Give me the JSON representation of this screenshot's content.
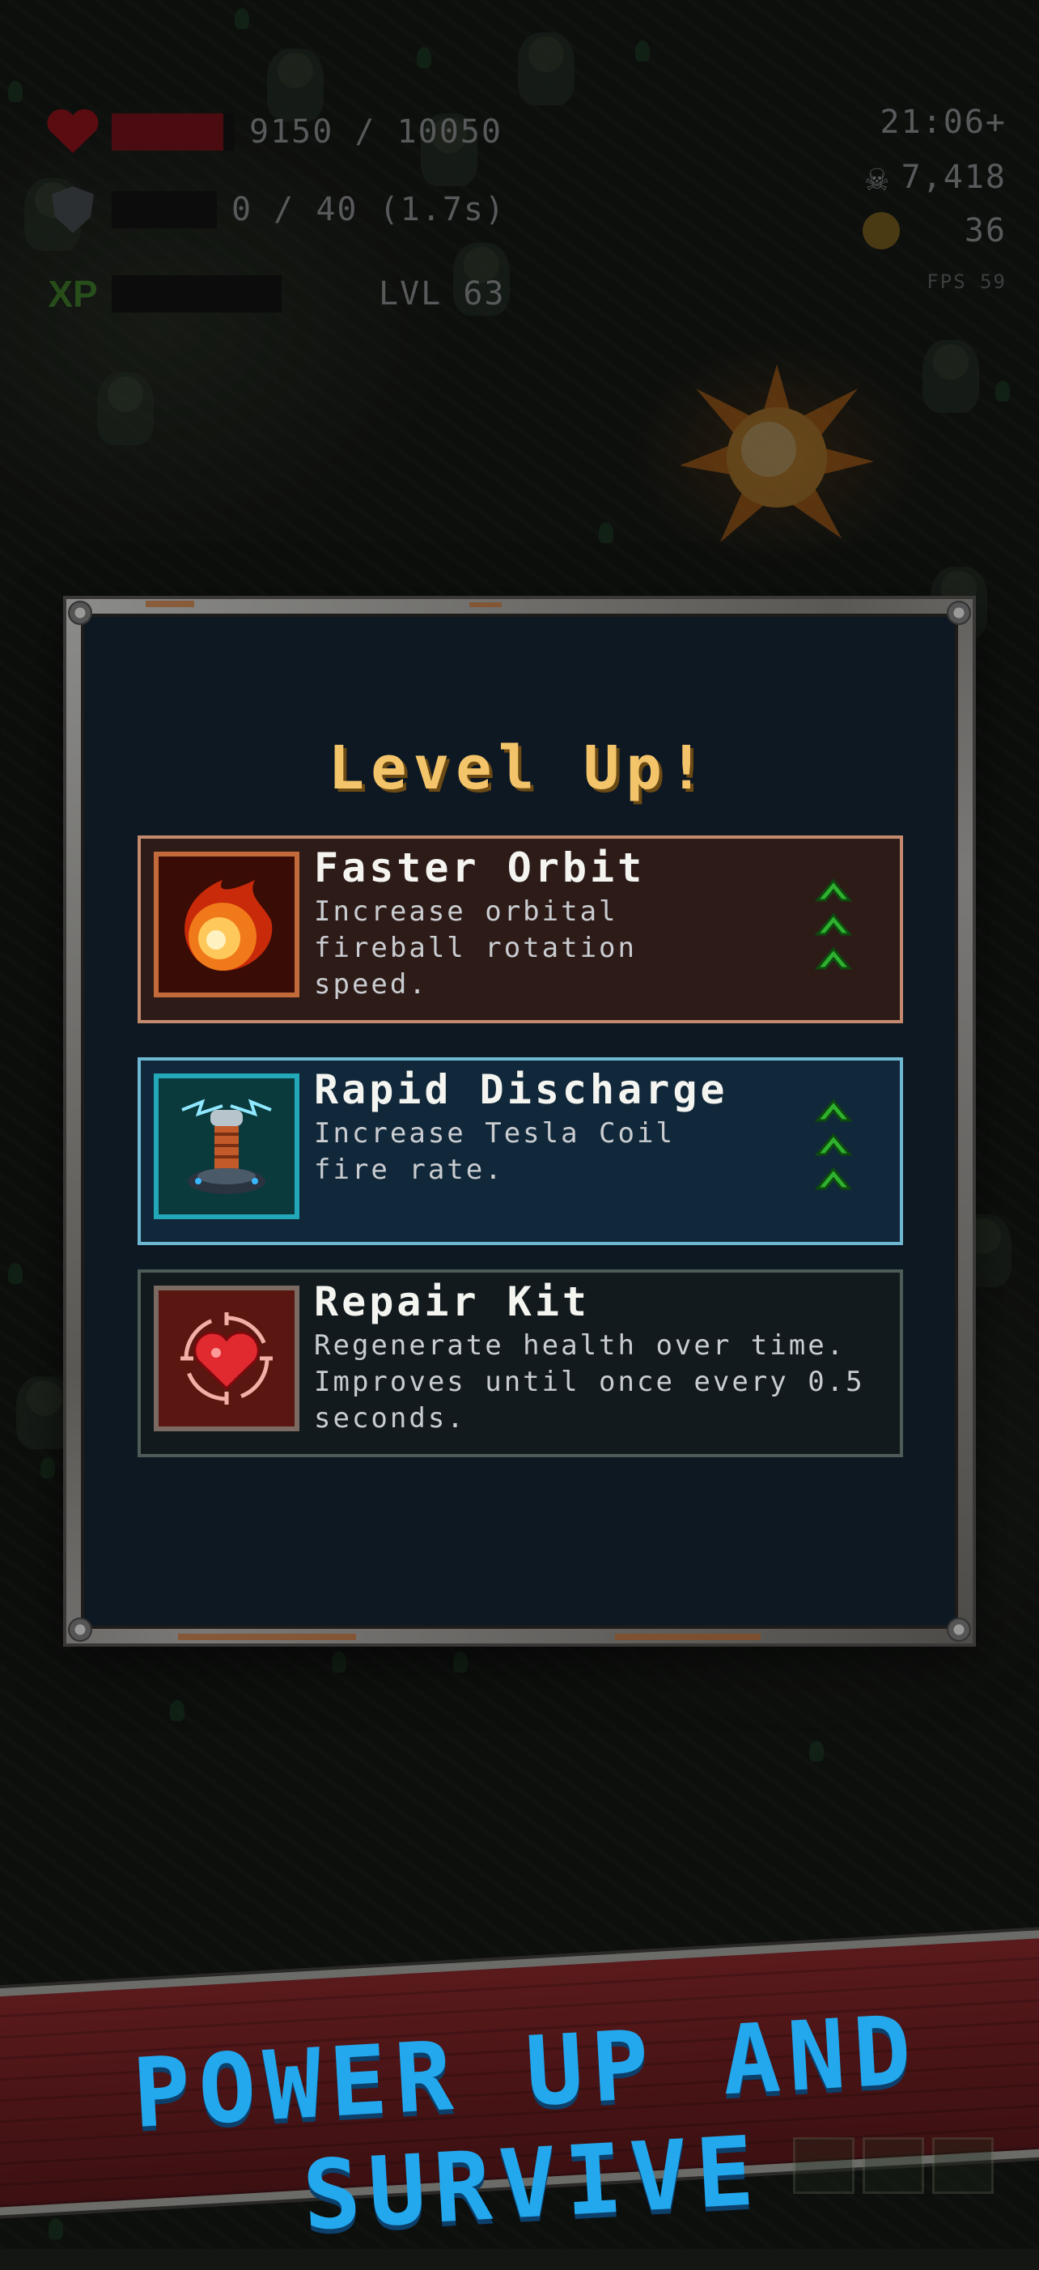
{
  "hud": {
    "health_text": "9150 / 10050",
    "health_fraction": 0.91,
    "shield_text": "0 / 40 (1.7s)",
    "shield_fraction": 0,
    "xp_label": "XP",
    "level_text": "LVL 63",
    "timer": "21:06+",
    "kills": "7,418",
    "coins": "36",
    "fps": "FPS 59"
  },
  "dialog": {
    "title": "Level Up!",
    "options": [
      {
        "title": "Faster Orbit",
        "description": "Increase orbital\nfireball rotation\nspeed.",
        "icon": "fireball-icon",
        "upgrade_arrows": 3
      },
      {
        "title": "Rapid Discharge",
        "description": "Increase Tesla Coil\nfire rate.",
        "icon": "tesla-coil-icon",
        "upgrade_arrows": 3
      },
      {
        "title": "Repair Kit",
        "description": "Regenerate health over time.\nImproves until once every 0.5\nseconds.",
        "icon": "heart-target-icon",
        "upgrade_arrows": 0
      }
    ]
  },
  "banner": {
    "text": "POWER UP AND SURVIVE"
  },
  "colors": {
    "title_gold": "#f4c46a",
    "banner_blue": "#23a8ee",
    "arrow_green": "#2fb12f",
    "health_red": "#4a0c10"
  }
}
